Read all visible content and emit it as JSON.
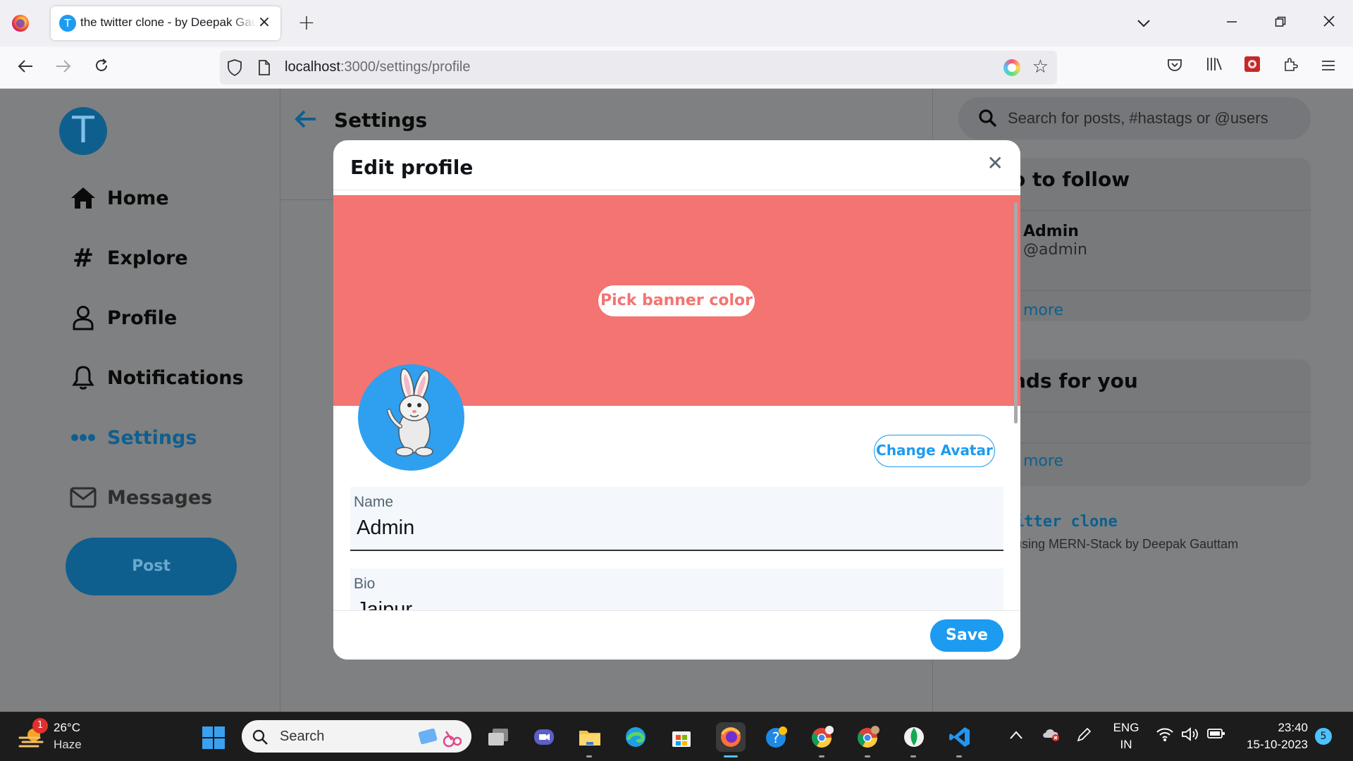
{
  "browser": {
    "tab_favicon_letter": "T",
    "tab_title": "the twitter clone - by Deepak Gauttam",
    "url_host": "localhost",
    "url_rest": ":3000/settings/profile"
  },
  "app": {
    "logo_letter": "T",
    "nav": [
      {
        "label": "Home"
      },
      {
        "label": "Explore"
      },
      {
        "label": "Profile"
      },
      {
        "label": "Notifications"
      },
      {
        "label": "Settings"
      },
      {
        "label": "Messages"
      }
    ],
    "post_label": "Post",
    "settings_title": "Settings",
    "search_placeholder": "Search for posts, #hastags or @users",
    "who_to_follow": {
      "title": "o to follow",
      "name": "Admin",
      "handle": "@admin",
      "more": "more"
    },
    "trends": {
      "title": "nds for you",
      "more": "more"
    },
    "footer_brand": "itter clone",
    "footer_sub": "using MERN-Stack by Deepak Gauttam"
  },
  "modal": {
    "title": "Edit profile",
    "banner_color": "#f37471",
    "pick_banner_label": "Pick banner color",
    "change_avatar_label": "Change Avatar",
    "name_label": "Name",
    "name_value": "Admin",
    "bio_label": "Bio",
    "bio_value": "Jaipur",
    "save_label": "Save"
  },
  "taskbar": {
    "weather_badge": "1",
    "temperature": "26°C",
    "condition": "Haze",
    "search_placeholder": "Search",
    "lang_top": "ENG",
    "lang_bottom": "IN",
    "time": "23:40",
    "date": "15-10-2023",
    "notification_count": "5"
  },
  "colors": {
    "accent": "#1d9bf0",
    "banner": "#f37471",
    "overlay": "#7f8081"
  }
}
